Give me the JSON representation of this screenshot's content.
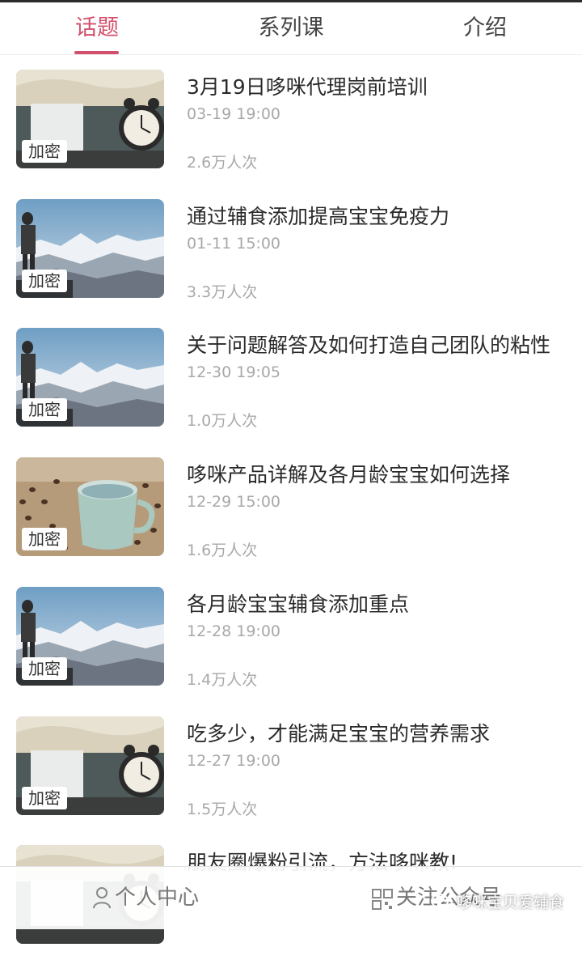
{
  "tabs": [
    {
      "label": "话题",
      "active": true
    },
    {
      "label": "系列课",
      "active": false
    },
    {
      "label": "介绍",
      "active": false
    }
  ],
  "accent_color": "#d2506b",
  "items": [
    {
      "title": "3月19日哆咪代理岗前培训",
      "date": "03-19 19:00",
      "views": "2.6万人次",
      "badge": "加密",
      "thumb": "clock"
    },
    {
      "title": "通过辅食添加提高宝宝免疫力",
      "date": "01-11 15:00",
      "views": "3.3万人次",
      "badge": "加密",
      "thumb": "mountain"
    },
    {
      "title": "关于问题解答及如何打造自己团队的粘性",
      "date": "12-30 19:05",
      "views": "1.0万人次",
      "badge": "加密",
      "thumb": "mountain"
    },
    {
      "title": "哆咪产品详解及各月龄宝宝如何选择",
      "date": "12-29 15:00",
      "views": "1.6万人次",
      "badge": "加密",
      "thumb": "coffee"
    },
    {
      "title": "各月龄宝宝辅食添加重点",
      "date": "12-28 19:00",
      "views": "1.4万人次",
      "badge": "加密",
      "thumb": "mountain"
    },
    {
      "title": "吃多少，才能满足宝宝的营养需求",
      "date": "12-27 19:00",
      "views": "1.5万人次",
      "badge": "加密",
      "thumb": "clock"
    },
    {
      "title": "朋友圈爆粉引流，方法哆咪教!",
      "date": "",
      "views": "",
      "badge": "",
      "thumb": "clock"
    }
  ],
  "bottom_bar": {
    "left_label": "个人中心",
    "left_icon": "person-icon",
    "right_label": "关注公众号",
    "right_icon": "qrcode-icon"
  },
  "watermark": {
    "text": "哆咪宝贝爱辅食",
    "icon": "wechat-icon"
  }
}
